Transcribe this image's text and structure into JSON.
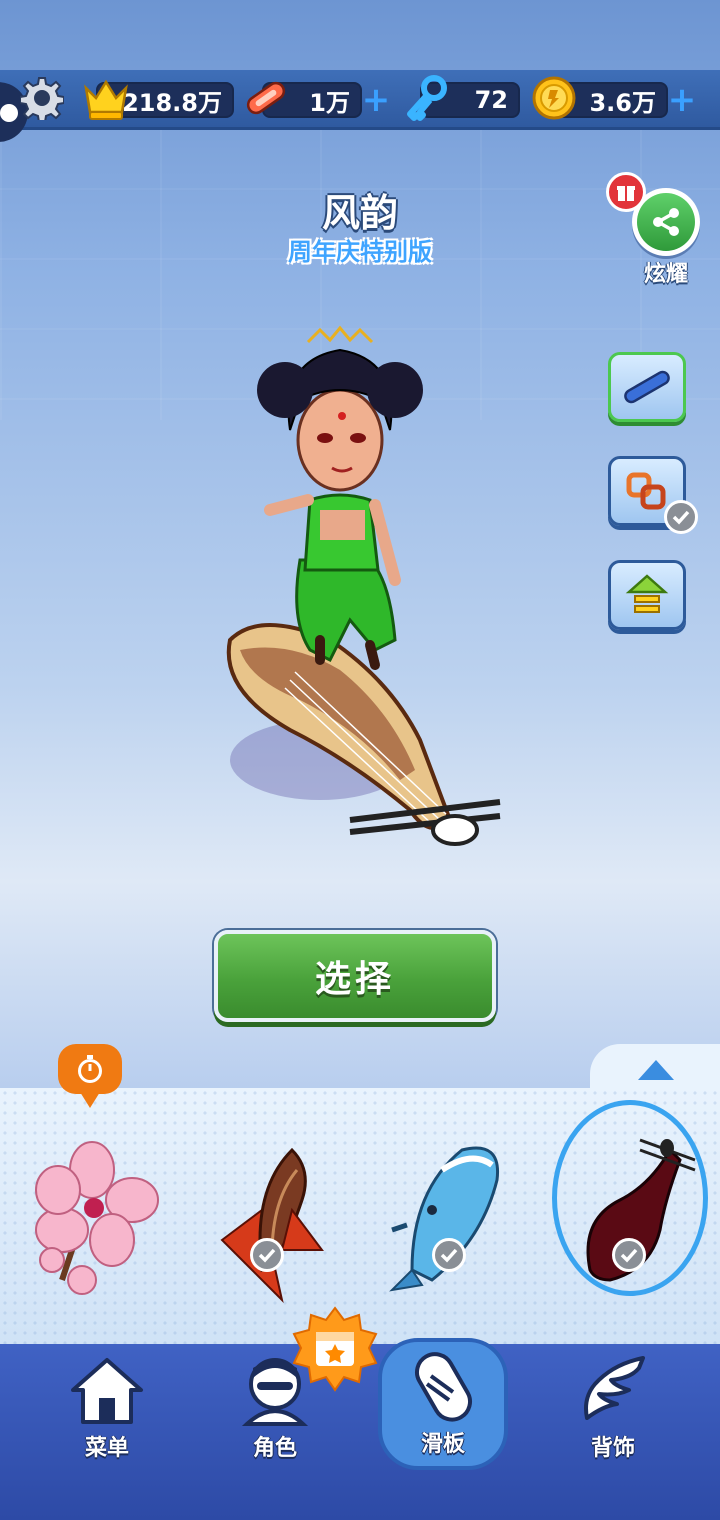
{
  "top_bar": {
    "crowns": "218.8万",
    "boards": "1万",
    "keys": "72",
    "coins": "3.6万"
  },
  "board": {
    "name": "风韵",
    "edition": "周年庆特别版"
  },
  "share": {
    "label": "炫耀"
  },
  "select_button": {
    "label": "选择"
  },
  "board_list": [
    {
      "icon": "cherry-blossom-board"
    },
    {
      "icon": "dragon-boat-board",
      "owned": true
    },
    {
      "icon": "whale-board",
      "owned": true
    },
    {
      "icon": "pipa-board",
      "owned": true,
      "selected": true
    }
  ],
  "nav": {
    "menu": "菜单",
    "character": "角色",
    "board": "滑板",
    "back_accessory": "背饰"
  },
  "colors": {
    "accent_green": "#4aa23b",
    "accent_blue": "#3aa4f0",
    "nav_blue": "#2d4aa6"
  }
}
